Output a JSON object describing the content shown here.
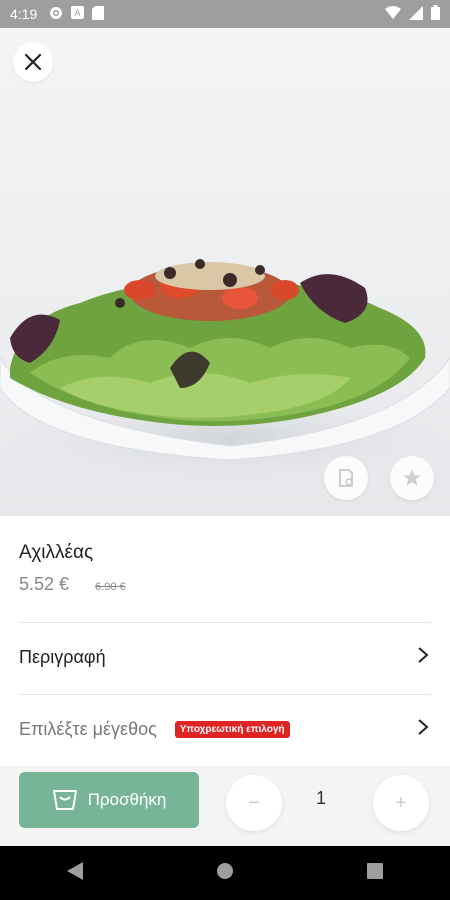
{
  "status_bar": {
    "time": "4:19",
    "icons": [
      "gear-icon",
      "a-box-icon",
      "sd-card-icon"
    ],
    "right_icons": [
      "wifi-icon",
      "signal-icon",
      "battery-icon"
    ]
  },
  "hero": {
    "background": "#eceef0",
    "close_icon": "close-icon",
    "action_icons": [
      "receipt-icon",
      "star-icon"
    ]
  },
  "product": {
    "name": "Αχιλλέας",
    "price": "5.52 €",
    "old_price": "6.90 €"
  },
  "rows": {
    "description": "Περιγραφή",
    "size": "Επιλέξτε μέγεθος",
    "size_badge": "Υποχρεωτική επιλογή"
  },
  "bottom": {
    "add_label": "Προσθήκη",
    "quantity": "1",
    "minus": "−",
    "plus": "+",
    "accent": "#77b498"
  },
  "navbar": {
    "icons": [
      "back-icon",
      "home-icon",
      "recents-icon"
    ]
  }
}
